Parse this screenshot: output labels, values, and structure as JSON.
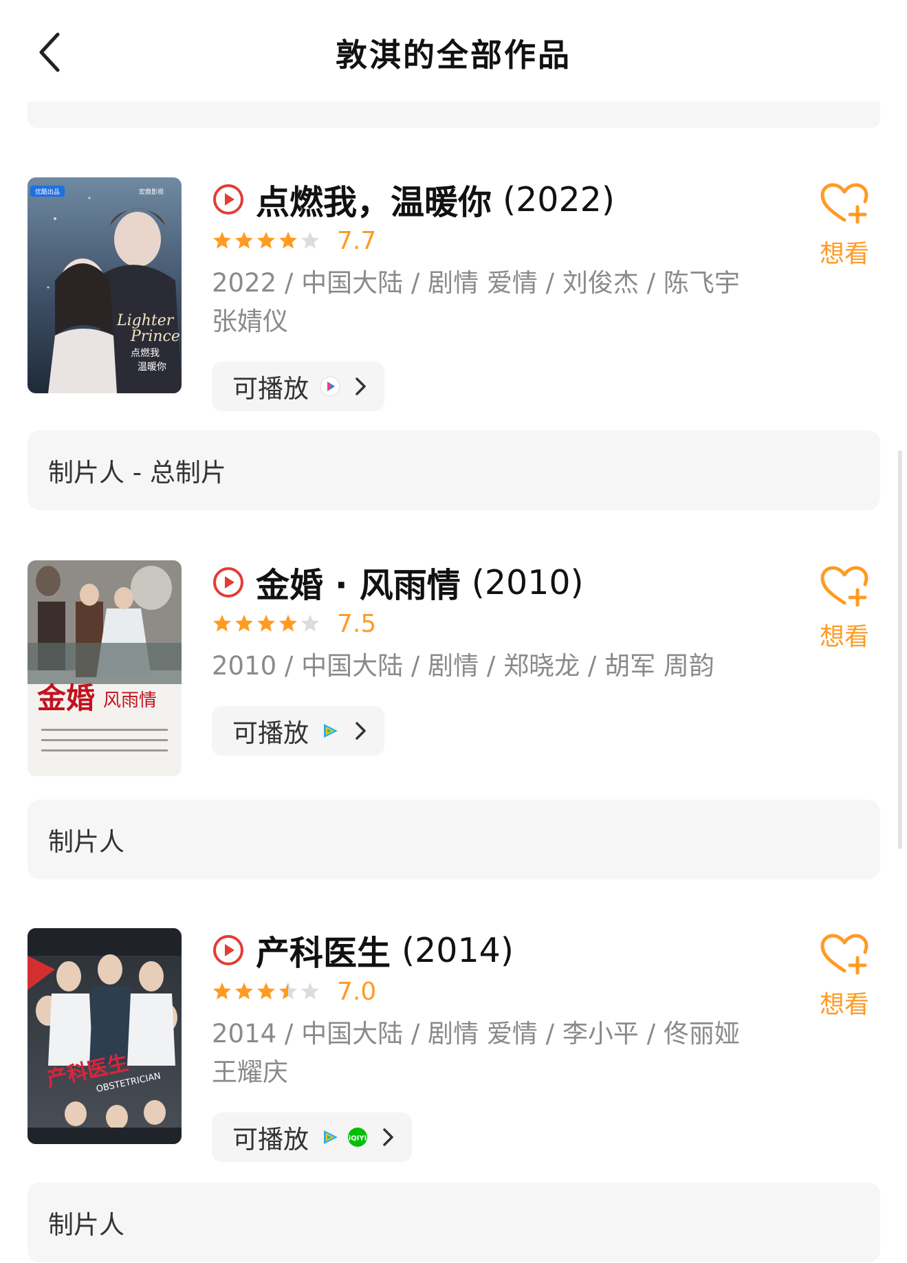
{
  "header": {
    "title": "敦淇的全部作品"
  },
  "colors": {
    "accent": "#ff9b23",
    "play_red": "#e33c36",
    "background": "#ffffff",
    "card": "#f6f6f6"
  },
  "movies": [
    {
      "title": "点燃我，温暖你",
      "year": "(2022)",
      "rating": 7.7,
      "stars": 4,
      "score": "7.7",
      "meta": "2022 / 中国大陆 / 剧情 爱情 / 刘俊杰 / 陈飞宇 张婧仪",
      "playable_label": "可播放",
      "sources": [
        "youku-icon"
      ],
      "want_label": "想看",
      "role": "制片人 - 总制片"
    },
    {
      "title": "金婚 · 风雨情",
      "year": "(2010)",
      "rating": 7.5,
      "stars": 4,
      "score": "7.5",
      "meta": "2010 / 中国大陆 / 剧情 / 郑晓龙 / 胡军 周韵",
      "playable_label": "可播放",
      "sources": [
        "tencent-video-icon"
      ],
      "want_label": "想看",
      "role": "制片人"
    },
    {
      "title": "产科医生",
      "year": "(2014)",
      "rating": 7.0,
      "stars": 3.5,
      "score": "7.0",
      "meta": "2014 / 中国大陆 / 剧情 爱情 / 李小平 / 佟丽娅 王耀庆",
      "playable_label": "可播放",
      "sources": [
        "tencent-video-icon",
        "iqiyi-icon"
      ],
      "want_label": "想看",
      "role": "制片人"
    }
  ]
}
